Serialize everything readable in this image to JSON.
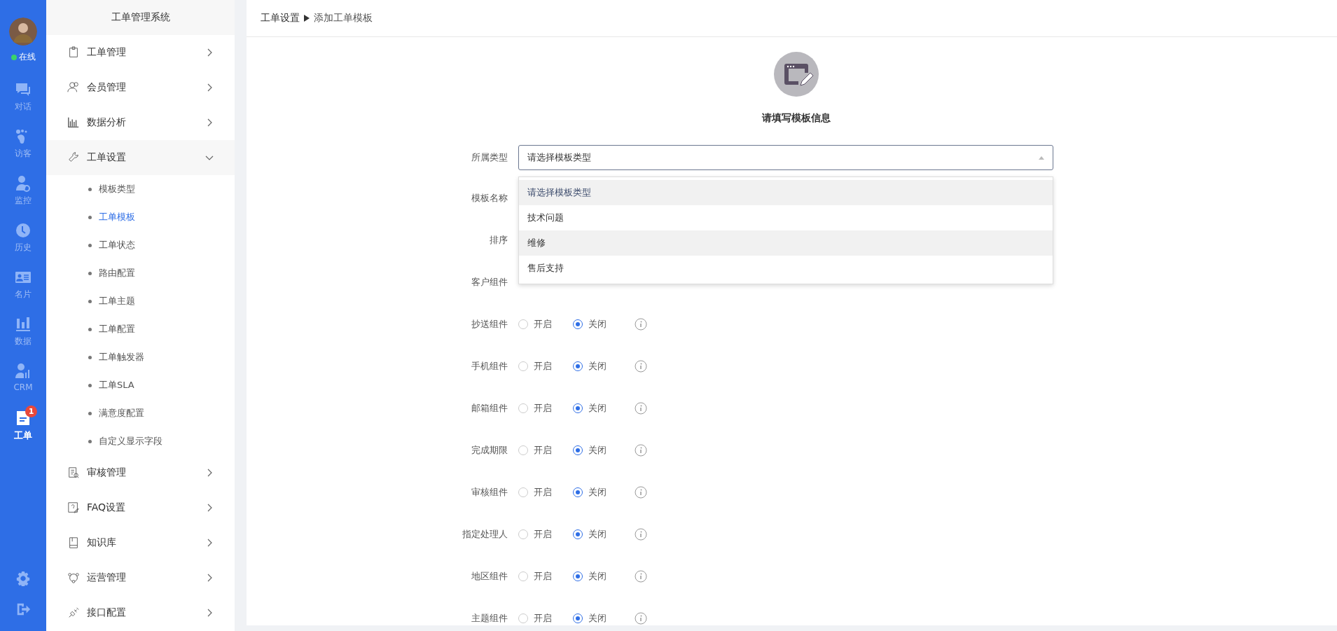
{
  "rail": {
    "status": "在线",
    "online": true,
    "items": [
      {
        "label": "对话",
        "selected": false
      },
      {
        "label": "访客",
        "selected": false
      },
      {
        "label": "监控",
        "selected": false
      },
      {
        "label": "历史",
        "selected": false
      },
      {
        "label": "名片",
        "selected": false
      },
      {
        "label": "数据",
        "selected": false
      },
      {
        "label": "CRM",
        "selected": false
      },
      {
        "label": "工单",
        "selected": true,
        "badge": "1"
      }
    ]
  },
  "sidebar": {
    "title": "工单管理系统",
    "groups": [
      {
        "label": "工单管理",
        "expanded": false
      },
      {
        "label": "会员管理",
        "expanded": false
      },
      {
        "label": "数据分析",
        "expanded": false
      },
      {
        "label": "工单设置",
        "expanded": true,
        "children": [
          {
            "label": "模板类型",
            "selected": false
          },
          {
            "label": "工单模板",
            "selected": true
          },
          {
            "label": "工单状态",
            "selected": false
          },
          {
            "label": "路由配置",
            "selected": false
          },
          {
            "label": "工单主题",
            "selected": false
          },
          {
            "label": "工单配置",
            "selected": false
          },
          {
            "label": "工单触发器",
            "selected": false
          },
          {
            "label": "工单SLA",
            "selected": false
          },
          {
            "label": "满意度配置",
            "selected": false
          },
          {
            "label": "自定义显示字段",
            "selected": false
          }
        ]
      },
      {
        "label": "审核管理",
        "expanded": false
      },
      {
        "label": "FAQ设置",
        "expanded": false
      },
      {
        "label": "知识库",
        "expanded": false
      },
      {
        "label": "运营管理",
        "expanded": false
      },
      {
        "label": "接口配置",
        "expanded": false
      }
    ]
  },
  "breadcrumb": [
    "工单设置",
    "添加工单模板"
  ],
  "form": {
    "title": "请填写模板信息",
    "rows": [
      {
        "kind": "select",
        "label": "所属类型",
        "value": "请选择模板类型",
        "expanded": true,
        "options": [
          {
            "label": "请选择模板类型",
            "selected": true,
            "hovered": false
          },
          {
            "label": "技术问题",
            "selected": false,
            "hovered": false
          },
          {
            "label": "维修",
            "selected": false,
            "hovered": true
          },
          {
            "label": "售后支持",
            "selected": false,
            "hovered": false
          }
        ]
      },
      {
        "kind": "covered",
        "label": "模板名称"
      },
      {
        "kind": "covered",
        "label": "排序"
      },
      {
        "kind": "covered",
        "label": "客户组件"
      },
      {
        "kind": "toggle",
        "label": "抄送组件",
        "options": [
          {
            "label": "开启",
            "selected": false
          },
          {
            "label": "关闭",
            "selected": true
          }
        ]
      },
      {
        "kind": "toggle",
        "label": "手机组件",
        "options": [
          {
            "label": "开启",
            "selected": false
          },
          {
            "label": "关闭",
            "selected": true
          }
        ]
      },
      {
        "kind": "toggle",
        "label": "邮箱组件",
        "options": [
          {
            "label": "开启",
            "selected": false
          },
          {
            "label": "关闭",
            "selected": true
          }
        ]
      },
      {
        "kind": "toggle",
        "label": "完成期限",
        "options": [
          {
            "label": "开启",
            "selected": false
          },
          {
            "label": "关闭",
            "selected": true
          }
        ]
      },
      {
        "kind": "toggle",
        "label": "审核组件",
        "options": [
          {
            "label": "开启",
            "selected": false
          },
          {
            "label": "关闭",
            "selected": true
          }
        ]
      },
      {
        "kind": "toggle",
        "label": "指定处理人",
        "options": [
          {
            "label": "开启",
            "selected": false
          },
          {
            "label": "关闭",
            "selected": true
          }
        ]
      },
      {
        "kind": "toggle",
        "label": "地区组件",
        "options": [
          {
            "label": "开启",
            "selected": false
          },
          {
            "label": "关闭",
            "selected": true
          }
        ]
      },
      {
        "kind": "toggle",
        "label": "主题组件",
        "options": [
          {
            "label": "开启",
            "selected": false
          },
          {
            "label": "关闭",
            "selected": true
          }
        ]
      }
    ]
  }
}
